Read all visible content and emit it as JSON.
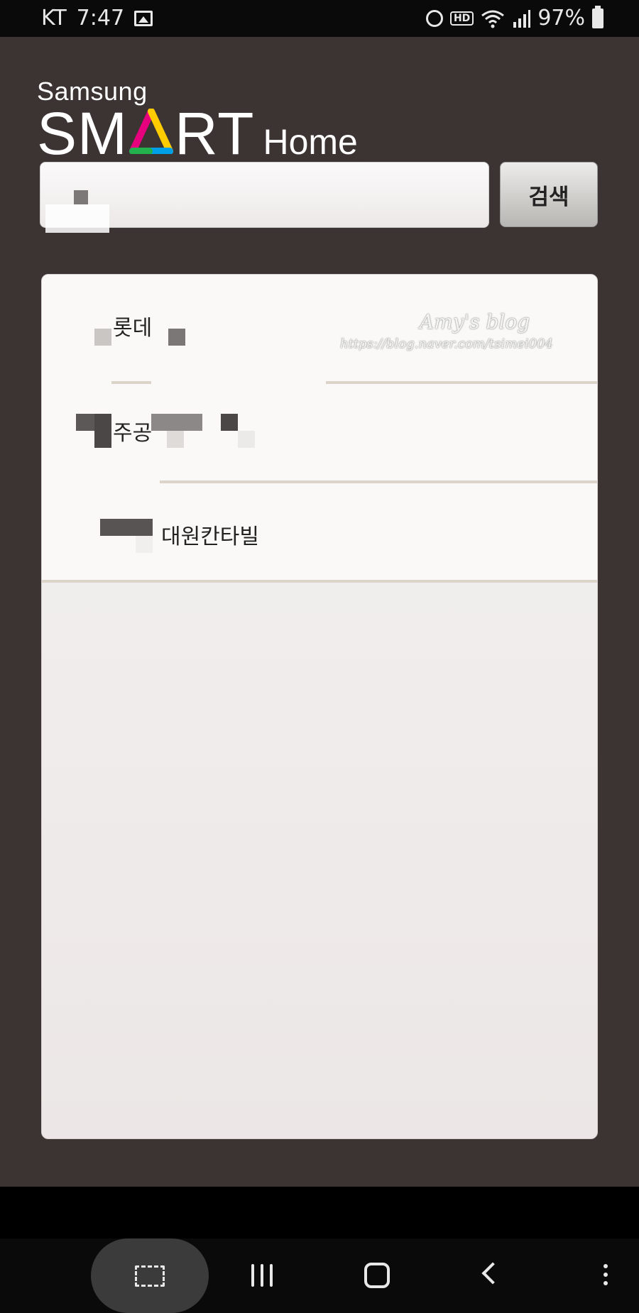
{
  "status_bar": {
    "carrier": "KT",
    "time": "7:47",
    "hd_label": "HD",
    "battery": "97%"
  },
  "logo": {
    "brand": "Samsung",
    "smart": "SM",
    "smart_tail": "RT",
    "home": "Home"
  },
  "search": {
    "value": "",
    "button_label": "검색"
  },
  "results": [
    {
      "label": "롯데"
    },
    {
      "label": "주공"
    },
    {
      "label": "대원칸타빌"
    }
  ],
  "watermark": {
    "title": "Amy's blog",
    "url": "https://blog.naver.com/tsimei004"
  },
  "icons": {
    "gallery": "gallery-icon",
    "alarm": "alarm-icon",
    "wifi": "wifi-icon",
    "signal": "signal-icon",
    "battery": "battery-icon",
    "capture": "capture-icon",
    "recents": "recents-icon",
    "home": "home-icon",
    "back": "back-icon",
    "more": "more-icon"
  }
}
